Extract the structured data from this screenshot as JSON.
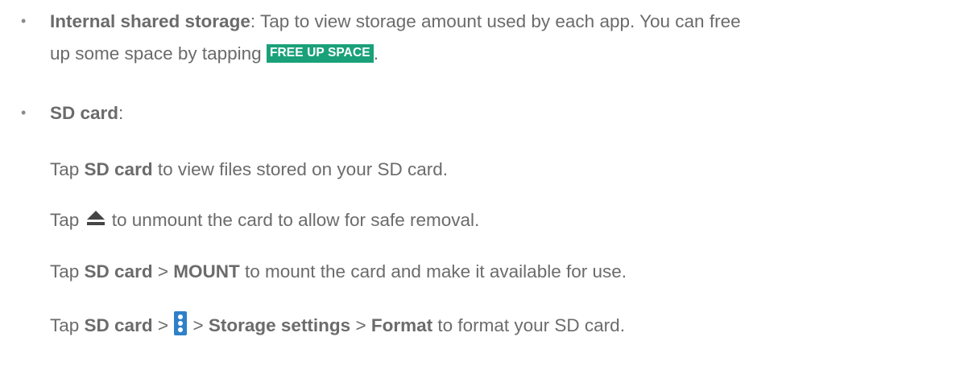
{
  "bullets": [
    "•",
    "•"
  ],
  "internal": {
    "title": "Internal shared storage",
    "text1": ": Tap to view storage amount used by each app. You can free",
    "text2": "up some space by tapping ",
    "button": "FREE UP SPACE",
    "end": "."
  },
  "sd": {
    "title": "SD card",
    "colon": ":",
    "l1": {
      "a": "Tap ",
      "b": "SD card",
      "c": " to view files stored on your SD card."
    },
    "l2": {
      "a": "Tap ",
      "icon": "eject-icon",
      "c": " to unmount the card to allow for safe removal."
    },
    "l3": {
      "a": "Tap ",
      "b": "SD card",
      "c": " > ",
      "d": "MOUNT",
      "e": " to mount the card and make it available for use."
    },
    "l4": {
      "a": "Tap ",
      "b": "SD card",
      "c": " > ",
      "icon": "more-vert-icon",
      "d": " > ",
      "e": "Storage settings",
      "f": " > ",
      "g": "Format",
      "h": " to format your SD card."
    }
  },
  "colors": {
    "text": "#6b6b6b",
    "button_bg": "#1aa179",
    "menu_icon_bg": "#2e80c9"
  }
}
